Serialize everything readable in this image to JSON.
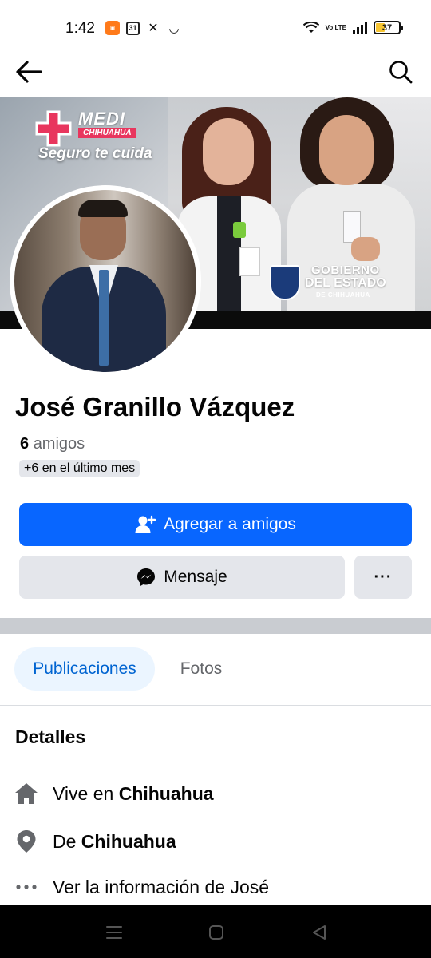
{
  "status_bar": {
    "time": "1:42",
    "calendar_day": "31",
    "volte": "Vo LTE",
    "battery": "37"
  },
  "cover": {
    "medi_title": "MEDI",
    "medi_subtitle": "CHIHUAHUA",
    "medi_slogan": "Seguro te cuida",
    "gob_line1": "GOBIERNO",
    "gob_line2": "DEL ESTADO",
    "gob_line3": "DE CHIHUAHUA"
  },
  "profile": {
    "name": "José Granillo Vázquez",
    "friends_count": "6",
    "friends_label": "amigos",
    "friends_badge": "+6 en el último mes"
  },
  "actions": {
    "add_friend": "Agregar a amigos",
    "message": "Mensaje",
    "more": "···"
  },
  "tabs": [
    {
      "label": "Publicaciones",
      "active": true
    },
    {
      "label": "Fotos",
      "active": false
    }
  ],
  "details": {
    "title": "Detalles",
    "lives_prefix": "Vive en",
    "lives_city": "Chihuahua",
    "from_prefix": "De",
    "from_city": "Chihuahua",
    "info_link": "Ver la información de José"
  },
  "colors": {
    "primary": "#0866ff",
    "tab_active_bg": "#ebf5ff",
    "tab_active_text": "#0064d1",
    "secondary_button": "#e4e6eb"
  },
  "icons": {
    "back": "arrow-left-icon",
    "search": "search-icon",
    "add_friend": "person-plus-icon",
    "message": "messenger-icon",
    "home": "home-icon",
    "location": "location-pin-icon",
    "more": "more-dots-icon"
  }
}
